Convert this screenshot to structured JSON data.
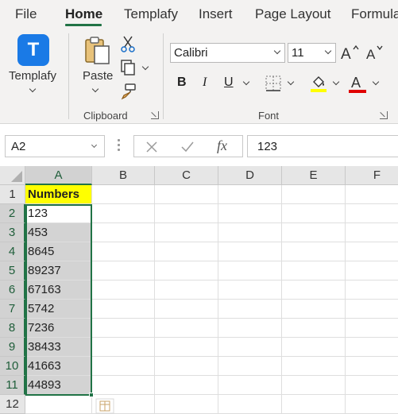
{
  "ribbon_tabs": [
    "File",
    "Home",
    "Templafy",
    "Insert",
    "Page Layout",
    "Formula"
  ],
  "active_tab": "Home",
  "groups": {
    "templafy": {
      "label": "Templafy",
      "logo_letter": "T"
    },
    "clipboard": {
      "label": "Clipboard",
      "paste_label": "Paste"
    },
    "font": {
      "label": "Font",
      "font_name": "Calibri",
      "font_size": "11"
    }
  },
  "formula_bar": {
    "name_box": "A2",
    "formula": "123"
  },
  "grid": {
    "columns": [
      "A",
      "B",
      "C",
      "D",
      "E",
      "F"
    ],
    "rows": [
      "1",
      "2",
      "3",
      "4",
      "5",
      "6",
      "7",
      "8",
      "9",
      "10",
      "11",
      "12"
    ],
    "column_a": [
      "Numbers",
      "123",
      "453",
      "8645",
      "89237",
      "67163",
      "5742",
      "7236",
      "38433",
      "41663",
      "44893",
      ""
    ]
  },
  "colors": {
    "accent": "#217346",
    "header_fill": "#ffff00",
    "selection_fill": "#d3d3d3",
    "templafy_blue": "#1a7ae6",
    "highlight_yellow": "#ffff00",
    "font_red": "#e00000"
  },
  "icons": [
    "templafy-logo",
    "paste-icon",
    "cut-icon",
    "copy-icon",
    "format-painter-icon",
    "increase-font-icon",
    "decrease-font-icon",
    "borders-icon",
    "fill-color-icon",
    "font-color-icon",
    "cancel-icon",
    "enter-icon",
    "fx-icon",
    "quick-analysis-icon"
  ]
}
